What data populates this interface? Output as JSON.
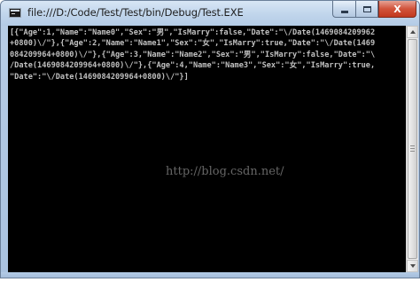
{
  "window": {
    "title": "file:///D:/Code/Test/Test/bin/Debug/Test.EXE",
    "buttons": {
      "minimize": "minimize",
      "maximize": "maximize",
      "close": "X"
    }
  },
  "console": {
    "output": "[{\"Age\":1,\"Name\":\"Name0\",\"Sex\":\"男\",\"IsMarry\":false,\"Date\":\"\\/Date(1469084209962\n+0800)\\/\"},{\"Age\":2,\"Name\":\"Name1\",\"Sex\":\"女\",\"IsMarry\":true,\"Date\":\"\\/Date(1469\n084209964+0800)\\/\"},{\"Age\":3,\"Name\":\"Name2\",\"Sex\":\"男\",\"IsMarry\":false,\"Date\":\"\\\n/Date(1469084209964+0800)\\/\"},{\"Age\":4,\"Name\":\"Name3\",\"Sex\":\"女\",\"IsMarry\":true,\n\"Date\":\"\\/Date(1469084209964+0800)\\/\"}]",
    "watermark": "http://blog.csdn.net/"
  },
  "colors": {
    "console_background": "#000000",
    "console_text": "#c0c0c0",
    "titlebar": "#c2d6ec",
    "close_button": "#c2391f"
  },
  "icons": {
    "app": "console-app-icon",
    "minimize": "minimize-icon",
    "maximize": "maximize-icon",
    "close": "close-icon",
    "scroll_up": "scroll-up-arrow-icon",
    "scroll_down": "scroll-down-arrow-icon"
  }
}
